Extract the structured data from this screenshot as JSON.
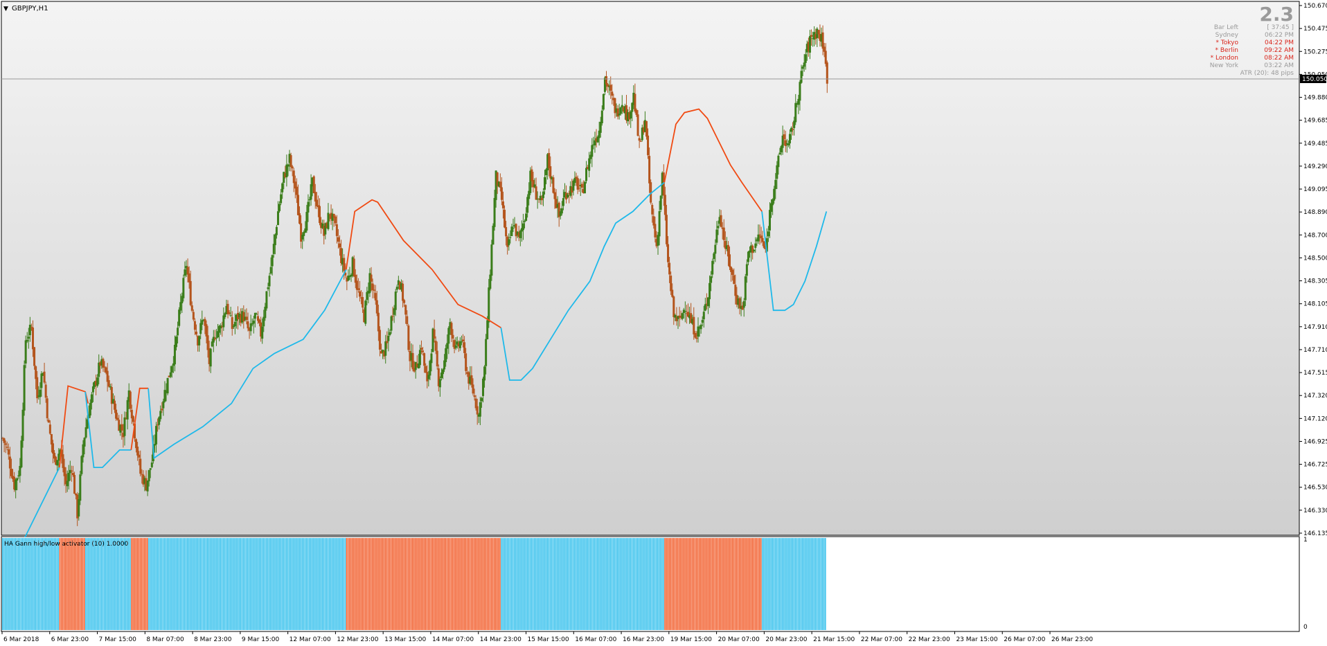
{
  "symbol": "GBPJPY,H1",
  "indicator_label": "HA Gann high/low activator (10) 1.0000",
  "info_panel": {
    "big_value": "2.3",
    "rows": [
      {
        "label": "Bar Left",
        "value": "[ 37:45 ]",
        "highlight": false
      },
      {
        "label": "Sydney",
        "value": "06:22 PM",
        "highlight": false
      },
      {
        "label": "* Tokyo",
        "value": "04:22 PM",
        "highlight": true
      },
      {
        "label": "* Berlin",
        "value": "09:22 AM",
        "highlight": true
      },
      {
        "label": "* London",
        "value": "08:22 AM",
        "highlight": true
      },
      {
        "label": "New York",
        "value": "03:22 AM",
        "highlight": false
      }
    ],
    "atr": "ATR (20): 48 pips"
  },
  "colors": {
    "bull": "#3a7d1a",
    "bear": "#b4541c",
    "activator_up": "#1eb9ea",
    "activator_down": "#f04a12",
    "info_normal": "#9a9a9a",
    "info_highlight": "#d9241a",
    "current_price_bg": "#000000"
  },
  "price_axis": {
    "labels": [
      "150.670",
      "150.475",
      "150.275",
      "150.050",
      "149.880",
      "149.685",
      "149.485",
      "149.290",
      "149.095",
      "148.890",
      "148.700",
      "148.500",
      "148.305",
      "148.105",
      "147.910",
      "147.710",
      "147.515",
      "147.320",
      "147.120",
      "146.925",
      "146.725",
      "146.530",
      "146.330",
      "146.135"
    ],
    "current_price": "150.050"
  },
  "indicator_axis": {
    "labels": [
      "1",
      "0"
    ]
  },
  "time_axis": {
    "labels": [
      "6 Mar 2018",
      "6 Mar 23:00",
      "7 Mar 15:00",
      "8 Mar 07:00",
      "8 Mar 23:00",
      "9 Mar 15:00",
      "12 Mar 07:00",
      "12 Mar 23:00",
      "13 Mar 15:00",
      "14 Mar 07:00",
      "14 Mar 23:00",
      "15 Mar 15:00",
      "16 Mar 07:00",
      "16 Mar 23:00",
      "19 Mar 15:00",
      "20 Mar 07:00",
      "20 Mar 23:00",
      "21 Mar 15:00",
      "22 Mar 07:00",
      "22 Mar 23:00",
      "23 Mar 15:00",
      "26 Mar 07:00",
      "26 Mar 23:00"
    ]
  },
  "chart_data": {
    "type": "candlestick",
    "series_path_points": [
      [
        0,
        146.95
      ],
      [
        3,
        146.85
      ],
      [
        8,
        146.55
      ],
      [
        12,
        146.7
      ],
      [
        16,
        147.8
      ],
      [
        20,
        147.9
      ],
      [
        24,
        147.3
      ],
      [
        28,
        147.55
      ],
      [
        32,
        147.05
      ],
      [
        36,
        146.75
      ],
      [
        40,
        146.85
      ],
      [
        44,
        146.55
      ],
      [
        48,
        146.72
      ],
      [
        52,
        146.3
      ],
      [
        56,
        146.9
      ],
      [
        60,
        147.2
      ],
      [
        64,
        147.4
      ],
      [
        68,
        147.6
      ],
      [
        72,
        147.5
      ],
      [
        76,
        147.3
      ],
      [
        80,
        147.1
      ],
      [
        84,
        147.0
      ],
      [
        88,
        147.35
      ],
      [
        92,
        147.0
      ],
      [
        96,
        146.65
      ],
      [
        100,
        146.55
      ],
      [
        104,
        146.75
      ],
      [
        108,
        147.1
      ],
      [
        112,
        147.3
      ],
      [
        116,
        147.5
      ],
      [
        120,
        147.7
      ],
      [
        124,
        148.1
      ],
      [
        128,
        148.45
      ],
      [
        132,
        148.05
      ],
      [
        136,
        147.8
      ],
      [
        140,
        148.0
      ],
      [
        144,
        147.6
      ],
      [
        148,
        147.85
      ],
      [
        152,
        147.9
      ],
      [
        156,
        148.1
      ],
      [
        160,
        147.9
      ],
      [
        164,
        148.0
      ],
      [
        168,
        148.0
      ],
      [
        172,
        147.85
      ],
      [
        176,
        148.0
      ],
      [
        180,
        147.85
      ],
      [
        184,
        148.2
      ],
      [
        188,
        148.5
      ],
      [
        192,
        148.9
      ],
      [
        196,
        149.2
      ],
      [
        200,
        149.35
      ],
      [
        204,
        149.1
      ],
      [
        208,
        148.7
      ],
      [
        212,
        148.85
      ],
      [
        216,
        149.15
      ],
      [
        220,
        148.9
      ],
      [
        224,
        148.7
      ],
      [
        228,
        148.9
      ],
      [
        232,
        148.75
      ],
      [
        236,
        148.5
      ],
      [
        240,
        148.3
      ],
      [
        244,
        148.45
      ],
      [
        248,
        148.2
      ],
      [
        252,
        148.0
      ],
      [
        256,
        148.35
      ],
      [
        260,
        148.1
      ],
      [
        264,
        147.65
      ],
      [
        268,
        147.75
      ],
      [
        272,
        148.05
      ],
      [
        276,
        148.35
      ],
      [
        280,
        148.1
      ],
      [
        284,
        147.65
      ],
      [
        288,
        147.55
      ],
      [
        292,
        147.75
      ],
      [
        296,
        147.4
      ],
      [
        300,
        147.85
      ],
      [
        304,
        147.45
      ],
      [
        308,
        147.6
      ],
      [
        312,
        147.95
      ],
      [
        316,
        147.7
      ],
      [
        320,
        147.8
      ],
      [
        324,
        147.5
      ],
      [
        328,
        147.35
      ],
      [
        332,
        147.15
      ],
      [
        336,
        147.55
      ],
      [
        340,
        148.4
      ],
      [
        344,
        149.2
      ],
      [
        348,
        149.0
      ],
      [
        352,
        148.55
      ],
      [
        356,
        148.8
      ],
      [
        360,
        148.65
      ],
      [
        364,
        148.85
      ],
      [
        368,
        149.2
      ],
      [
        372,
        149.05
      ],
      [
        376,
        148.95
      ],
      [
        380,
        149.35
      ],
      [
        384,
        149.1
      ],
      [
        388,
        148.85
      ],
      [
        392,
        149.05
      ],
      [
        396,
        149.1
      ],
      [
        400,
        149.15
      ],
      [
        404,
        149.05
      ],
      [
        408,
        149.3
      ],
      [
        412,
        149.5
      ],
      [
        416,
        149.6
      ],
      [
        420,
        150.05
      ],
      [
        424,
        149.9
      ],
      [
        428,
        149.75
      ],
      [
        432,
        149.85
      ],
      [
        436,
        149.7
      ],
      [
        440,
        149.9
      ],
      [
        444,
        149.45
      ],
      [
        448,
        149.7
      ],
      [
        452,
        148.95
      ],
      [
        456,
        148.6
      ],
      [
        460,
        149.2
      ],
      [
        464,
        148.45
      ],
      [
        468,
        148.0
      ],
      [
        472,
        147.95
      ],
      [
        476,
        148.1
      ],
      [
        480,
        147.95
      ],
      [
        484,
        147.85
      ],
      [
        488,
        147.95
      ],
      [
        492,
        148.2
      ],
      [
        496,
        148.55
      ],
      [
        500,
        148.9
      ],
      [
        504,
        148.6
      ],
      [
        508,
        148.4
      ],
      [
        512,
        148.15
      ],
      [
        516,
        148.05
      ],
      [
        520,
        148.55
      ],
      [
        524,
        148.6
      ],
      [
        528,
        148.7
      ],
      [
        532,
        148.55
      ],
      [
        536,
        149.0
      ],
      [
        540,
        149.25
      ],
      [
        544,
        149.55
      ],
      [
        548,
        149.45
      ],
      [
        552,
        149.7
      ],
      [
        556,
        150.0
      ],
      [
        560,
        150.25
      ],
      [
        564,
        150.4
      ],
      [
        568,
        150.45
      ],
      [
        572,
        150.35
      ],
      [
        575,
        150.05
      ]
    ],
    "price_range": [
      146.135,
      150.67
    ],
    "activator_segments": [
      {
        "state": "up",
        "points": [
          [
            16,
            146.1
          ],
          [
            30,
            146.45
          ],
          [
            40,
            146.7
          ]
        ]
      },
      {
        "state": "down",
        "points": [
          [
            40,
            146.7
          ],
          [
            46,
            147.4
          ],
          [
            58,
            147.35
          ],
          [
            60,
            147.25
          ]
        ]
      },
      {
        "state": "up",
        "points": [
          [
            58,
            147.35
          ],
          [
            64,
            146.7
          ],
          [
            70,
            146.7
          ],
          [
            82,
            146.85
          ],
          [
            90,
            146.85
          ]
        ]
      },
      {
        "state": "down",
        "points": [
          [
            90,
            146.85
          ],
          [
            96,
            147.38
          ],
          [
            102,
            147.38
          ]
        ]
      },
      {
        "state": "up",
        "points": [
          [
            102,
            147.38
          ],
          [
            106,
            146.78
          ],
          [
            120,
            146.9
          ],
          [
            140,
            147.05
          ],
          [
            160,
            147.25
          ],
          [
            175,
            147.55
          ],
          [
            190,
            147.68
          ],
          [
            210,
            147.8
          ],
          [
            225,
            148.05
          ],
          [
            240,
            148.4
          ]
        ]
      },
      {
        "state": "down",
        "points": [
          [
            240,
            148.4
          ],
          [
            246,
            148.9
          ],
          [
            258,
            149.0
          ],
          [
            262,
            148.98
          ],
          [
            280,
            148.65
          ],
          [
            300,
            148.4
          ],
          [
            318,
            148.1
          ],
          [
            335,
            148.0
          ],
          [
            348,
            147.9
          ]
        ]
      },
      {
        "state": "up",
        "points": [
          [
            348,
            147.9
          ],
          [
            354,
            147.45
          ],
          [
            362,
            147.45
          ],
          [
            370,
            147.55
          ],
          [
            385,
            147.85
          ],
          [
            395,
            148.05
          ],
          [
            410,
            148.3
          ],
          [
            420,
            148.6
          ],
          [
            428,
            148.8
          ],
          [
            440,
            148.9
          ],
          [
            452,
            149.05
          ],
          [
            462,
            149.15
          ]
        ]
      },
      {
        "state": "down",
        "points": [
          [
            462,
            149.15
          ],
          [
            470,
            149.65
          ],
          [
            476,
            149.75
          ],
          [
            486,
            149.78
          ],
          [
            492,
            149.7
          ],
          [
            500,
            149.5
          ],
          [
            508,
            149.3
          ],
          [
            516,
            149.15
          ],
          [
            530,
            148.9
          ]
        ]
      },
      {
        "state": "up",
        "points": [
          [
            530,
            148.9
          ],
          [
            538,
            148.05
          ],
          [
            546,
            148.05
          ],
          [
            552,
            148.1
          ],
          [
            560,
            148.3
          ],
          [
            568,
            148.6
          ],
          [
            575,
            148.9
          ]
        ]
      }
    ],
    "indicator_blocks": [
      {
        "state": "up",
        "from": 0,
        "to": 40
      },
      {
        "state": "down",
        "from": 40,
        "to": 58
      },
      {
        "state": "up",
        "from": 58,
        "to": 90
      },
      {
        "state": "down",
        "from": 90,
        "to": 102
      },
      {
        "state": "up",
        "from": 102,
        "to": 240
      },
      {
        "state": "down",
        "from": 240,
        "to": 348
      },
      {
        "state": "up",
        "from": 348,
        "to": 462
      },
      {
        "state": "down",
        "from": 462,
        "to": 530
      },
      {
        "state": "up",
        "from": 530,
        "to": 575
      }
    ],
    "bar_count": 576,
    "indicator_range": [
      0,
      1
    ]
  }
}
